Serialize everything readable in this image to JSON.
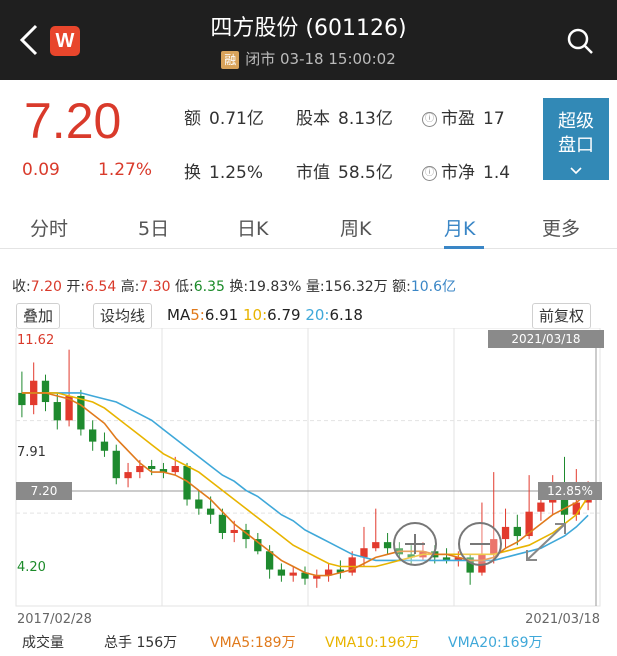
{
  "header": {
    "title": "四方股份 (601126)",
    "margin_badge": "融",
    "status": "闭市 03-18 15:00:02",
    "logo": "W"
  },
  "quote": {
    "price": "7.20",
    "change": "0.09",
    "change_pct": "1.27%",
    "amount_label": "额",
    "amount": "0.71亿",
    "equity_label": "股本",
    "equity": "8.13亿",
    "pe_label": "市盈",
    "pe": "17",
    "turnover_label": "换",
    "turnover": "1.25%",
    "mktcap_label": "市值",
    "mktcap": "58.5亿",
    "pb_label": "市净",
    "pb": "1.4",
    "info_icon": "ⓘ",
    "super_btn_line1": "超级",
    "super_btn_line2": "盘口"
  },
  "tabs": [
    "分时",
    "5日",
    "日K",
    "周K",
    "月K",
    "更多"
  ],
  "active_tab": "月K",
  "candle_info": {
    "close_label": "收:",
    "close": "7.20",
    "open_label": "开:",
    "open": "6.54",
    "high_label": "高:",
    "high": "7.30",
    "low_label": "低:",
    "low": "6.35",
    "turnover_label": "换:",
    "turnover": "19.83%",
    "volume_label": "量:",
    "volume": "156.32万",
    "amount_label": "额:",
    "amount": "10.6亿"
  },
  "toolbar": {
    "overlay": "叠加",
    "set_ma": "设均线",
    "adjust": "前复权",
    "ma_prefix": "MA",
    "ma5_label": "5:",
    "ma5": "6.91",
    "ma10_label": "10:",
    "ma10": "6.79",
    "ma20_label": "20:",
    "ma20": "6.18"
  },
  "chart_data": {
    "type": "candlestick",
    "period": "monthly",
    "x_start": "2017/02/28",
    "x_end": "2021/03/18",
    "cursor_date": "2021/03/18",
    "cursor_price": "7.20",
    "cursor_pct": "12.85%",
    "price_labels": [
      "11.62",
      "7.91",
      "4.20"
    ],
    "ylim": [
      3.4,
      12.2
    ],
    "colors": {
      "up": "#e23a2d",
      "down": "#1e8a2e",
      "ma5": "#e07a1c",
      "ma10": "#e8b400",
      "ma20": "#3fa8d9"
    },
    "candles": [
      [
        10.2,
        9.8,
        10.9,
        9.4
      ],
      [
        9.8,
        10.6,
        11.2,
        9.5
      ],
      [
        10.6,
        9.9,
        10.8,
        9.6
      ],
      [
        9.9,
        9.3,
        10.2,
        9.0
      ],
      [
        9.3,
        10.1,
        11.62,
        9.1
      ],
      [
        10.1,
        9.0,
        10.3,
        8.8
      ],
      [
        9.0,
        8.6,
        9.3,
        8.3
      ],
      [
        8.6,
        8.3,
        8.9,
        8.1
      ],
      [
        8.3,
        7.4,
        8.5,
        7.2
      ],
      [
        7.4,
        7.6,
        7.9,
        7.1
      ],
      [
        7.6,
        7.8,
        8.0,
        7.4
      ],
      [
        7.8,
        7.7,
        8.0,
        7.5
      ],
      [
        7.7,
        7.6,
        7.9,
        7.4
      ],
      [
        7.6,
        7.8,
        8.1,
        7.5
      ],
      [
        7.8,
        6.7,
        7.9,
        6.5
      ],
      [
        6.7,
        6.4,
        7.0,
        6.2
      ],
      [
        6.4,
        6.2,
        6.8,
        5.9
      ],
      [
        6.2,
        5.6,
        6.4,
        5.4
      ],
      [
        5.6,
        5.7,
        6.0,
        5.3
      ],
      [
        5.7,
        5.4,
        5.9,
        5.1
      ],
      [
        5.4,
        5.0,
        5.6,
        4.9
      ],
      [
        5.0,
        4.4,
        5.2,
        4.1
      ],
      [
        4.4,
        4.2,
        4.6,
        4.0
      ],
      [
        4.2,
        4.3,
        4.5,
        4.0
      ],
      [
        4.3,
        4.1,
        4.5,
        3.9
      ],
      [
        4.1,
        4.2,
        4.4,
        3.8
      ],
      [
        4.2,
        4.4,
        4.6,
        4.0
      ],
      [
        4.4,
        4.3,
        4.7,
        4.1
      ],
      [
        4.3,
        4.8,
        5.0,
        4.2
      ],
      [
        4.8,
        5.1,
        5.8,
        4.5
      ],
      [
        5.1,
        5.3,
        6.4,
        5.0
      ],
      [
        5.3,
        5.1,
        5.6,
        4.9
      ],
      [
        5.1,
        4.9,
        5.3,
        4.7
      ],
      [
        4.9,
        4.8,
        5.2,
        4.6
      ],
      [
        4.8,
        5.0,
        5.3,
        4.7
      ],
      [
        5.0,
        4.8,
        5.2,
        4.6
      ],
      [
        4.8,
        4.7,
        5.1,
        4.6
      ],
      [
        4.7,
        4.8,
        5.0,
        4.5
      ],
      [
        4.8,
        4.3,
        4.9,
        3.9
      ],
      [
        4.3,
        4.9,
        6.6,
        4.2
      ],
      [
        4.9,
        5.4,
        7.6,
        4.6
      ],
      [
        5.4,
        5.8,
        6.4,
        5.1
      ],
      [
        5.8,
        5.5,
        6.2,
        5.2
      ],
      [
        5.5,
        6.3,
        7.5,
        5.4
      ],
      [
        6.3,
        6.6,
        7.2,
        6.0
      ],
      [
        6.6,
        7.0,
        7.5,
        6.2
      ],
      [
        7.0,
        6.2,
        8.1,
        5.9
      ],
      [
        6.2,
        6.6,
        7.7,
        6.0
      ],
      [
        6.6,
        7.2,
        7.3,
        6.35
      ]
    ],
    "ma5": [
      10.2,
      10.2,
      10.2,
      10.1,
      10.0,
      9.8,
      9.5,
      9.2,
      8.7,
      8.3,
      7.9,
      7.6,
      7.6,
      7.5,
      7.3,
      7.0,
      6.7,
      6.3,
      5.9,
      5.6,
      5.3,
      5.0,
      4.7,
      4.5,
      4.3,
      4.2,
      4.2,
      4.3,
      4.4,
      4.6,
      4.8,
      4.9,
      5.0,
      5.0,
      5.0,
      4.9,
      4.9,
      4.8,
      4.7,
      4.7,
      4.8,
      5.1,
      5.3,
      5.6,
      5.9,
      6.2,
      6.4,
      6.6,
      6.91
    ],
    "ma10": [
      10.2,
      10.2,
      10.2,
      10.2,
      10.1,
      10.0,
      9.9,
      9.7,
      9.4,
      9.1,
      8.8,
      8.5,
      8.2,
      8.0,
      7.8,
      7.6,
      7.3,
      7.0,
      6.7,
      6.4,
      6.1,
      5.8,
      5.5,
      5.2,
      5.0,
      4.8,
      4.6,
      4.5,
      4.5,
      4.5,
      4.5,
      4.6,
      4.7,
      4.8,
      4.9,
      4.9,
      4.9,
      4.9,
      4.9,
      4.9,
      4.9,
      5.0,
      5.1,
      5.2,
      5.4,
      5.6,
      5.9,
      6.2,
      6.79
    ],
    "ma20": [
      10.2,
      10.2,
      10.2,
      10.2,
      10.2,
      10.2,
      10.1,
      10.0,
      9.9,
      9.7,
      9.5,
      9.3,
      9.0,
      8.7,
      8.4,
      8.1,
      7.8,
      7.5,
      7.3,
      7.0,
      6.8,
      6.5,
      6.2,
      6.0,
      5.7,
      5.5,
      5.3,
      5.1,
      4.9,
      4.8,
      4.7,
      4.7,
      4.7,
      4.7,
      4.7,
      4.7,
      4.7,
      4.7,
      4.7,
      4.7,
      4.7,
      4.8,
      4.9,
      5.0,
      5.1,
      5.3,
      5.5,
      5.8,
      6.18
    ]
  },
  "volume_bar": {
    "label": "成交量",
    "total_label": "总手",
    "total": "156万",
    "vma5_label": "VMA5:",
    "vma5": "189万",
    "vma10_label": "VMA10:",
    "vma10": "196万",
    "vma20_label": "VMA20:",
    "vma20": "169万"
  }
}
